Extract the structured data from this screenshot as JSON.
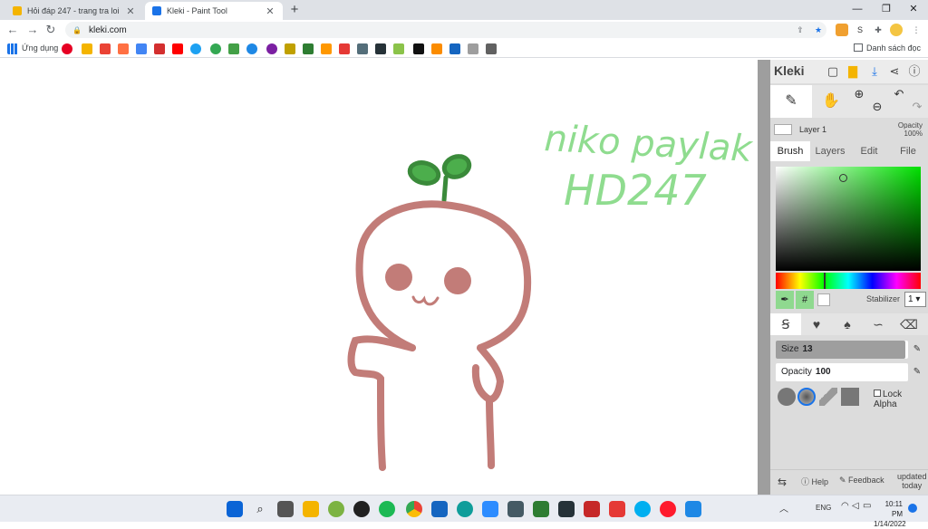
{
  "browser": {
    "tabs": [
      {
        "title": "Hỏi đáp 247 - trang tra loi",
        "color": "#f4b400",
        "active": false
      },
      {
        "title": "Kleki - Paint Tool",
        "color": "#1a73e8",
        "active": true
      }
    ],
    "new_tab": "+",
    "window_controls": {
      "minimize": "—",
      "maximize": "❐",
      "close": "✕"
    },
    "url": "kleki.com",
    "nav": {
      "back": "←",
      "forward": "→",
      "reload": "↻"
    },
    "bookmarks": {
      "apps_label": "Ứng dụng",
      "reading_list": "Danh sách đọc"
    }
  },
  "app": {
    "logo": "Kleki",
    "layer": {
      "name": "Layer 1",
      "opacity_label": "Opacity",
      "opacity_value": "100%"
    },
    "tabs": [
      "Brush",
      "Layers",
      "Edit",
      "File"
    ],
    "active_tab": "Brush",
    "picker": {
      "hue_color": "#00e000",
      "hue_position": 0.33
    },
    "stabilizer": {
      "label": "Stabilizer",
      "value": "1"
    },
    "size": {
      "label": "Size",
      "value": "13",
      "fill": 0.98
    },
    "opacity": {
      "label": "Opacity",
      "value": "100",
      "fill": 0.0
    },
    "lock_alpha": "Lock Alpha",
    "bottom": {
      "help": "Help",
      "feedback": "Feedback",
      "updated": "updated",
      "today": "today"
    },
    "canvas_text": [
      "niko paylak",
      "HD247"
    ]
  },
  "colors": {
    "stroke_body": "#c27c78",
    "cheeks": "#c27c78",
    "sprout": "#5cb85c",
    "text": "#8fdc8f"
  },
  "taskbar": {
    "lang": "ENG",
    "time": "10:11 PM",
    "date": "1/14/2022"
  }
}
